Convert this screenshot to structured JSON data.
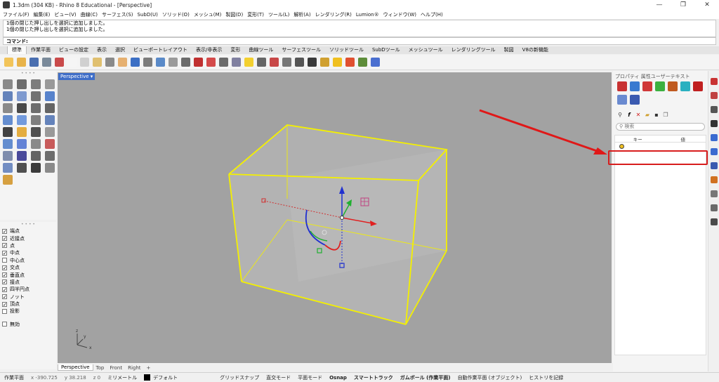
{
  "window": {
    "title": "1.3dm (304 KB) - Rhino 8 Educational - [Perspective]",
    "controls": [
      "—",
      "❐",
      "✕"
    ]
  },
  "menu": [
    "ファイル(F)",
    "編集(E)",
    "ビュー(V)",
    "曲線(C)",
    "サーフェス(S)",
    "SubD(U)",
    "ソリッド(O)",
    "メッシュ(M)",
    "製図(D)",
    "変形(T)",
    "ツール(L)",
    "解析(A)",
    "レンダリング(R)",
    "Lumion®",
    "ウィンドウ(W)",
    "ヘルプ(H)"
  ],
  "command": {
    "history": [
      "1個の閉じた押し出しを選択に追加しました。",
      "1個の閉じた押し出しを選択に追加しました。"
    ],
    "prompt": "コマンド:"
  },
  "toolbar_tabs": [
    "標準",
    "作業平面",
    "ビューの設定",
    "表示",
    "選択",
    "ビューポートレイアウト",
    "表示/非表示",
    "変形",
    "曲線ツール",
    "サーフェスツール",
    "ソリッドツール",
    "SubDツール",
    "メッシュツール",
    "レンダリングツール",
    "製図",
    "V8の新機能"
  ],
  "toolbar_icon_colors": [
    "#f2c45a",
    "#e8b34a",
    "#4a6fb0",
    "#7a8a9a",
    "#c94a4a",
    "#f5f5f5",
    "#d0d0d0",
    "#e0c070",
    "#8a8a8a",
    "#e6b070",
    "#3c6fc4",
    "#7c7c7c",
    "#5a8ac8",
    "#9a9a9a",
    "#6b6b6b",
    "#c03030",
    "#d44a4a",
    "#6b6b6b",
    "#8080a0",
    "#f3d030",
    "#666",
    "#c84848",
    "#777",
    "#555",
    "#3a3a3a",
    "#d0a030",
    "#f0c020",
    "#e05030",
    "#5e8d3a",
    "#4a6fd0"
  ],
  "viewport": {
    "title": "Perspective",
    "tabs": [
      "Perspective",
      "Top",
      "Front",
      "Right"
    ],
    "add_tab": "+",
    "axis_labels": {
      "x": "x",
      "y": "y",
      "z": "z"
    }
  },
  "osnap": [
    {
      "label": "端点",
      "checked": true
    },
    {
      "label": "近接点",
      "checked": true
    },
    {
      "label": "点",
      "checked": true
    },
    {
      "label": "中点",
      "checked": true
    },
    {
      "label": "中心点",
      "checked": false
    },
    {
      "label": "交点",
      "checked": true
    },
    {
      "label": "垂直点",
      "checked": true
    },
    {
      "label": "接点",
      "checked": true
    },
    {
      "label": "四半円点",
      "checked": true
    },
    {
      "label": "ノット",
      "checked": true
    },
    {
      "label": "頂点",
      "checked": true
    },
    {
      "label": "投影",
      "checked": false
    },
    {
      "label": "無効",
      "checked": false
    }
  ],
  "right_panel": {
    "header": "プロパティ 属性ユーザーテキスト",
    "search_placeholder": "検索",
    "columns": [
      "キー",
      "値"
    ]
  },
  "status": {
    "plane": "作業平面",
    "x": "x -390.725",
    "y": "y 38.218",
    "z": "z 0",
    "units": "ミリメートル",
    "layer": "デフォルト",
    "grid_snap": "グリッドスナップ",
    "ortho": "直交モード",
    "planar": "平面モード",
    "osnap": "Osnap",
    "smarttrack": "スマートトラック",
    "gumball": "ガムボール (作業平面)",
    "autoplane": "自動作業平面 (オブジェクト)",
    "history": "ヒストリを記録"
  },
  "colors": {
    "box": "#f4f000",
    "selection": "#d81d1d",
    "viewport_bg": "#a2a2a2",
    "active_tab": "#3f6ec8"
  }
}
